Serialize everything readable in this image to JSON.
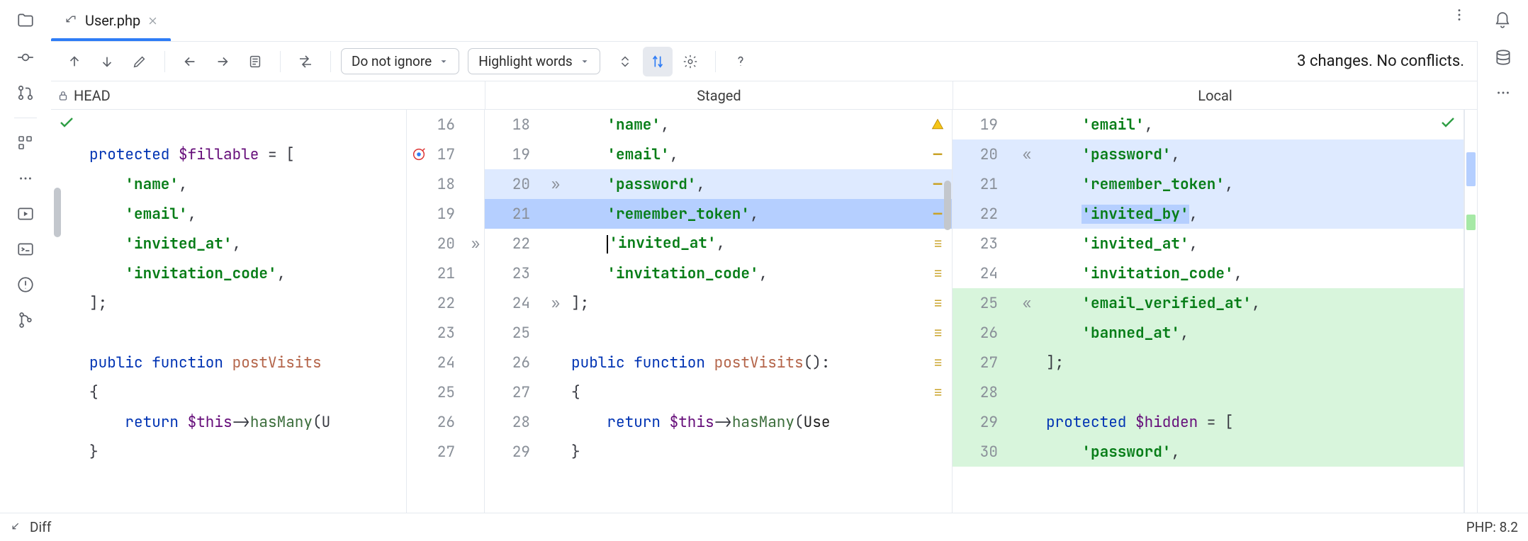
{
  "tab": {
    "filename": "User.php"
  },
  "toolbar": {
    "ignore_mode": "Do not ignore",
    "highlight_mode": "Highlight words",
    "status": "3 changes. No conflicts."
  },
  "panels": {
    "left": "HEAD",
    "mid": "Staged",
    "right": "Local"
  },
  "statusbar": {
    "left": "Diff",
    "right": "PHP: 8.2"
  },
  "left_pane": {
    "lines": [
      {
        "n": 16,
        "tokens": []
      },
      {
        "n": 17,
        "tokens": [
          [
            "kw",
            "protected "
          ],
          [
            "var",
            "$fillable"
          ],
          [
            "op",
            " = ["
          ]
        ],
        "run_to": true
      },
      {
        "n": 18,
        "tokens": [
          [
            "pad",
            "    "
          ],
          [
            "str",
            "'name'"
          ],
          [
            "punc",
            ","
          ]
        ]
      },
      {
        "n": 19,
        "tokens": [
          [
            "pad",
            "    "
          ],
          [
            "str",
            "'email'"
          ],
          [
            "punc",
            ","
          ]
        ]
      },
      {
        "n": 20,
        "tokens": [
          [
            "pad",
            "    "
          ],
          [
            "str",
            "'invited_at'"
          ],
          [
            "punc",
            ","
          ]
        ],
        "push": true
      },
      {
        "n": 21,
        "tokens": [
          [
            "pad",
            "    "
          ],
          [
            "str",
            "'invitation_code'"
          ],
          [
            "punc",
            ","
          ]
        ]
      },
      {
        "n": 22,
        "tokens": [
          [
            "punc",
            "];"
          ]
        ]
      },
      {
        "n": 23,
        "tokens": []
      },
      {
        "n": 24,
        "tokens": [
          [
            "kw",
            "public "
          ],
          [
            "kw",
            "function "
          ],
          [
            "fnname",
            "postVisits"
          ]
        ]
      },
      {
        "n": 25,
        "tokens": [
          [
            "punc",
            "{"
          ]
        ]
      },
      {
        "n": 26,
        "tokens": [
          [
            "pad",
            "    "
          ],
          [
            "kw",
            "return "
          ],
          [
            "var",
            "$this"
          ],
          [
            "op",
            "->"
          ],
          [
            "call",
            "hasMany"
          ],
          [
            "punc",
            "(U"
          ]
        ]
      },
      {
        "n": 27,
        "tokens": [
          [
            "punc",
            "}"
          ]
        ]
      }
    ]
  },
  "mid_pane": {
    "lines": [
      {
        "a": 18,
        "tokens": [
          [
            "pad",
            "    "
          ],
          [
            "str",
            "'name'"
          ],
          [
            "punc",
            ","
          ]
        ]
      },
      {
        "a": 19,
        "tokens": [
          [
            "pad",
            "    "
          ],
          [
            "str",
            "'email'"
          ],
          [
            "punc",
            ","
          ]
        ]
      },
      {
        "a": 20,
        "pull": true,
        "bg": "blue-soft",
        "tokens": [
          [
            "pad",
            "    "
          ],
          [
            "str",
            "'password'"
          ],
          [
            "punc",
            ","
          ]
        ]
      },
      {
        "a": 21,
        "bg": "blue",
        "tokens": [
          [
            "pad",
            "    "
          ],
          [
            "str",
            "'remember_token'"
          ],
          [
            "punc",
            ","
          ]
        ]
      },
      {
        "a": 22,
        "tokens": [
          [
            "pad",
            "    "
          ],
          [
            "caret",
            ""
          ],
          [
            "str",
            "'invited_at'"
          ],
          [
            "punc",
            ","
          ]
        ]
      },
      {
        "a": 23,
        "tokens": [
          [
            "pad",
            "    "
          ],
          [
            "str",
            "'invitation_code'"
          ],
          [
            "punc",
            ","
          ]
        ]
      },
      {
        "a": 24,
        "pull": true,
        "tokens": [
          [
            "punc",
            "];"
          ]
        ]
      },
      {
        "a": 25,
        "tokens": []
      },
      {
        "a": 26,
        "tokens": [
          [
            "kw",
            "public "
          ],
          [
            "kw",
            "function "
          ],
          [
            "fnname",
            "postVisits"
          ],
          [
            "punc",
            "():"
          ]
        ]
      },
      {
        "a": 27,
        "tokens": [
          [
            "punc",
            "{"
          ]
        ]
      },
      {
        "a": 28,
        "tokens": [
          [
            "pad",
            "    "
          ],
          [
            "kw",
            "return "
          ],
          [
            "var",
            "$this"
          ],
          [
            "op",
            "->"
          ],
          [
            "call",
            "hasMany"
          ],
          [
            "punc",
            "("
          ],
          [
            "id",
            "Use"
          ]
        ]
      },
      {
        "a": 29,
        "tokens": [
          [
            "punc",
            "}"
          ]
        ]
      }
    ],
    "warn_row": 0
  },
  "right_pane": {
    "lines": [
      {
        "n": 19,
        "tokens": [
          [
            "pad",
            "    "
          ],
          [
            "str",
            "'email'"
          ],
          [
            "punc",
            ","
          ]
        ]
      },
      {
        "n": 20,
        "bg": "blue-soft",
        "mark": "«",
        "tokens": [
          [
            "pad",
            "    "
          ],
          [
            "str",
            "'password'"
          ],
          [
            "punc",
            ","
          ]
        ]
      },
      {
        "n": 21,
        "bg": "blue-soft",
        "tokens": [
          [
            "pad",
            "    "
          ],
          [
            "str",
            "'remember_token'"
          ],
          [
            "punc",
            ","
          ]
        ]
      },
      {
        "n": 22,
        "bg": "blue-soft",
        "tokens": [
          [
            "pad",
            "    "
          ],
          [
            "hl-blue",
            [
              "str",
              "'invited_by'"
            ]
          ],
          [
            "punc",
            ","
          ]
        ]
      },
      {
        "n": 23,
        "tokens": [
          [
            "pad",
            "    "
          ],
          [
            "str",
            "'invited_at'"
          ],
          [
            "punc",
            ","
          ]
        ]
      },
      {
        "n": 24,
        "tokens": [
          [
            "pad",
            "    "
          ],
          [
            "str",
            "'invitation_code'"
          ],
          [
            "punc",
            ","
          ]
        ]
      },
      {
        "n": 25,
        "bg": "green-soft",
        "mark": "«",
        "tokens": [
          [
            "pad",
            "    "
          ],
          [
            "str",
            "'email_verified_at'"
          ],
          [
            "punc",
            ","
          ]
        ]
      },
      {
        "n": 26,
        "bg": "green-soft",
        "tokens": [
          [
            "pad",
            "    "
          ],
          [
            "str",
            "'banned_at'"
          ],
          [
            "punc",
            ","
          ]
        ]
      },
      {
        "n": 27,
        "bg": "green-soft",
        "tokens": [
          [
            "punc",
            "];"
          ]
        ]
      },
      {
        "n": 28,
        "bg": "green-soft",
        "tokens": []
      },
      {
        "n": 29,
        "bg": "green-soft",
        "tokens": [
          [
            "kw",
            "protected "
          ],
          [
            "var",
            "$hidden"
          ],
          [
            "op",
            " = ["
          ]
        ]
      },
      {
        "n": 30,
        "bg": "green-soft",
        "tokens": [
          [
            "pad",
            "    "
          ],
          [
            "str",
            "'password'"
          ],
          [
            "punc",
            ","
          ]
        ]
      }
    ]
  }
}
